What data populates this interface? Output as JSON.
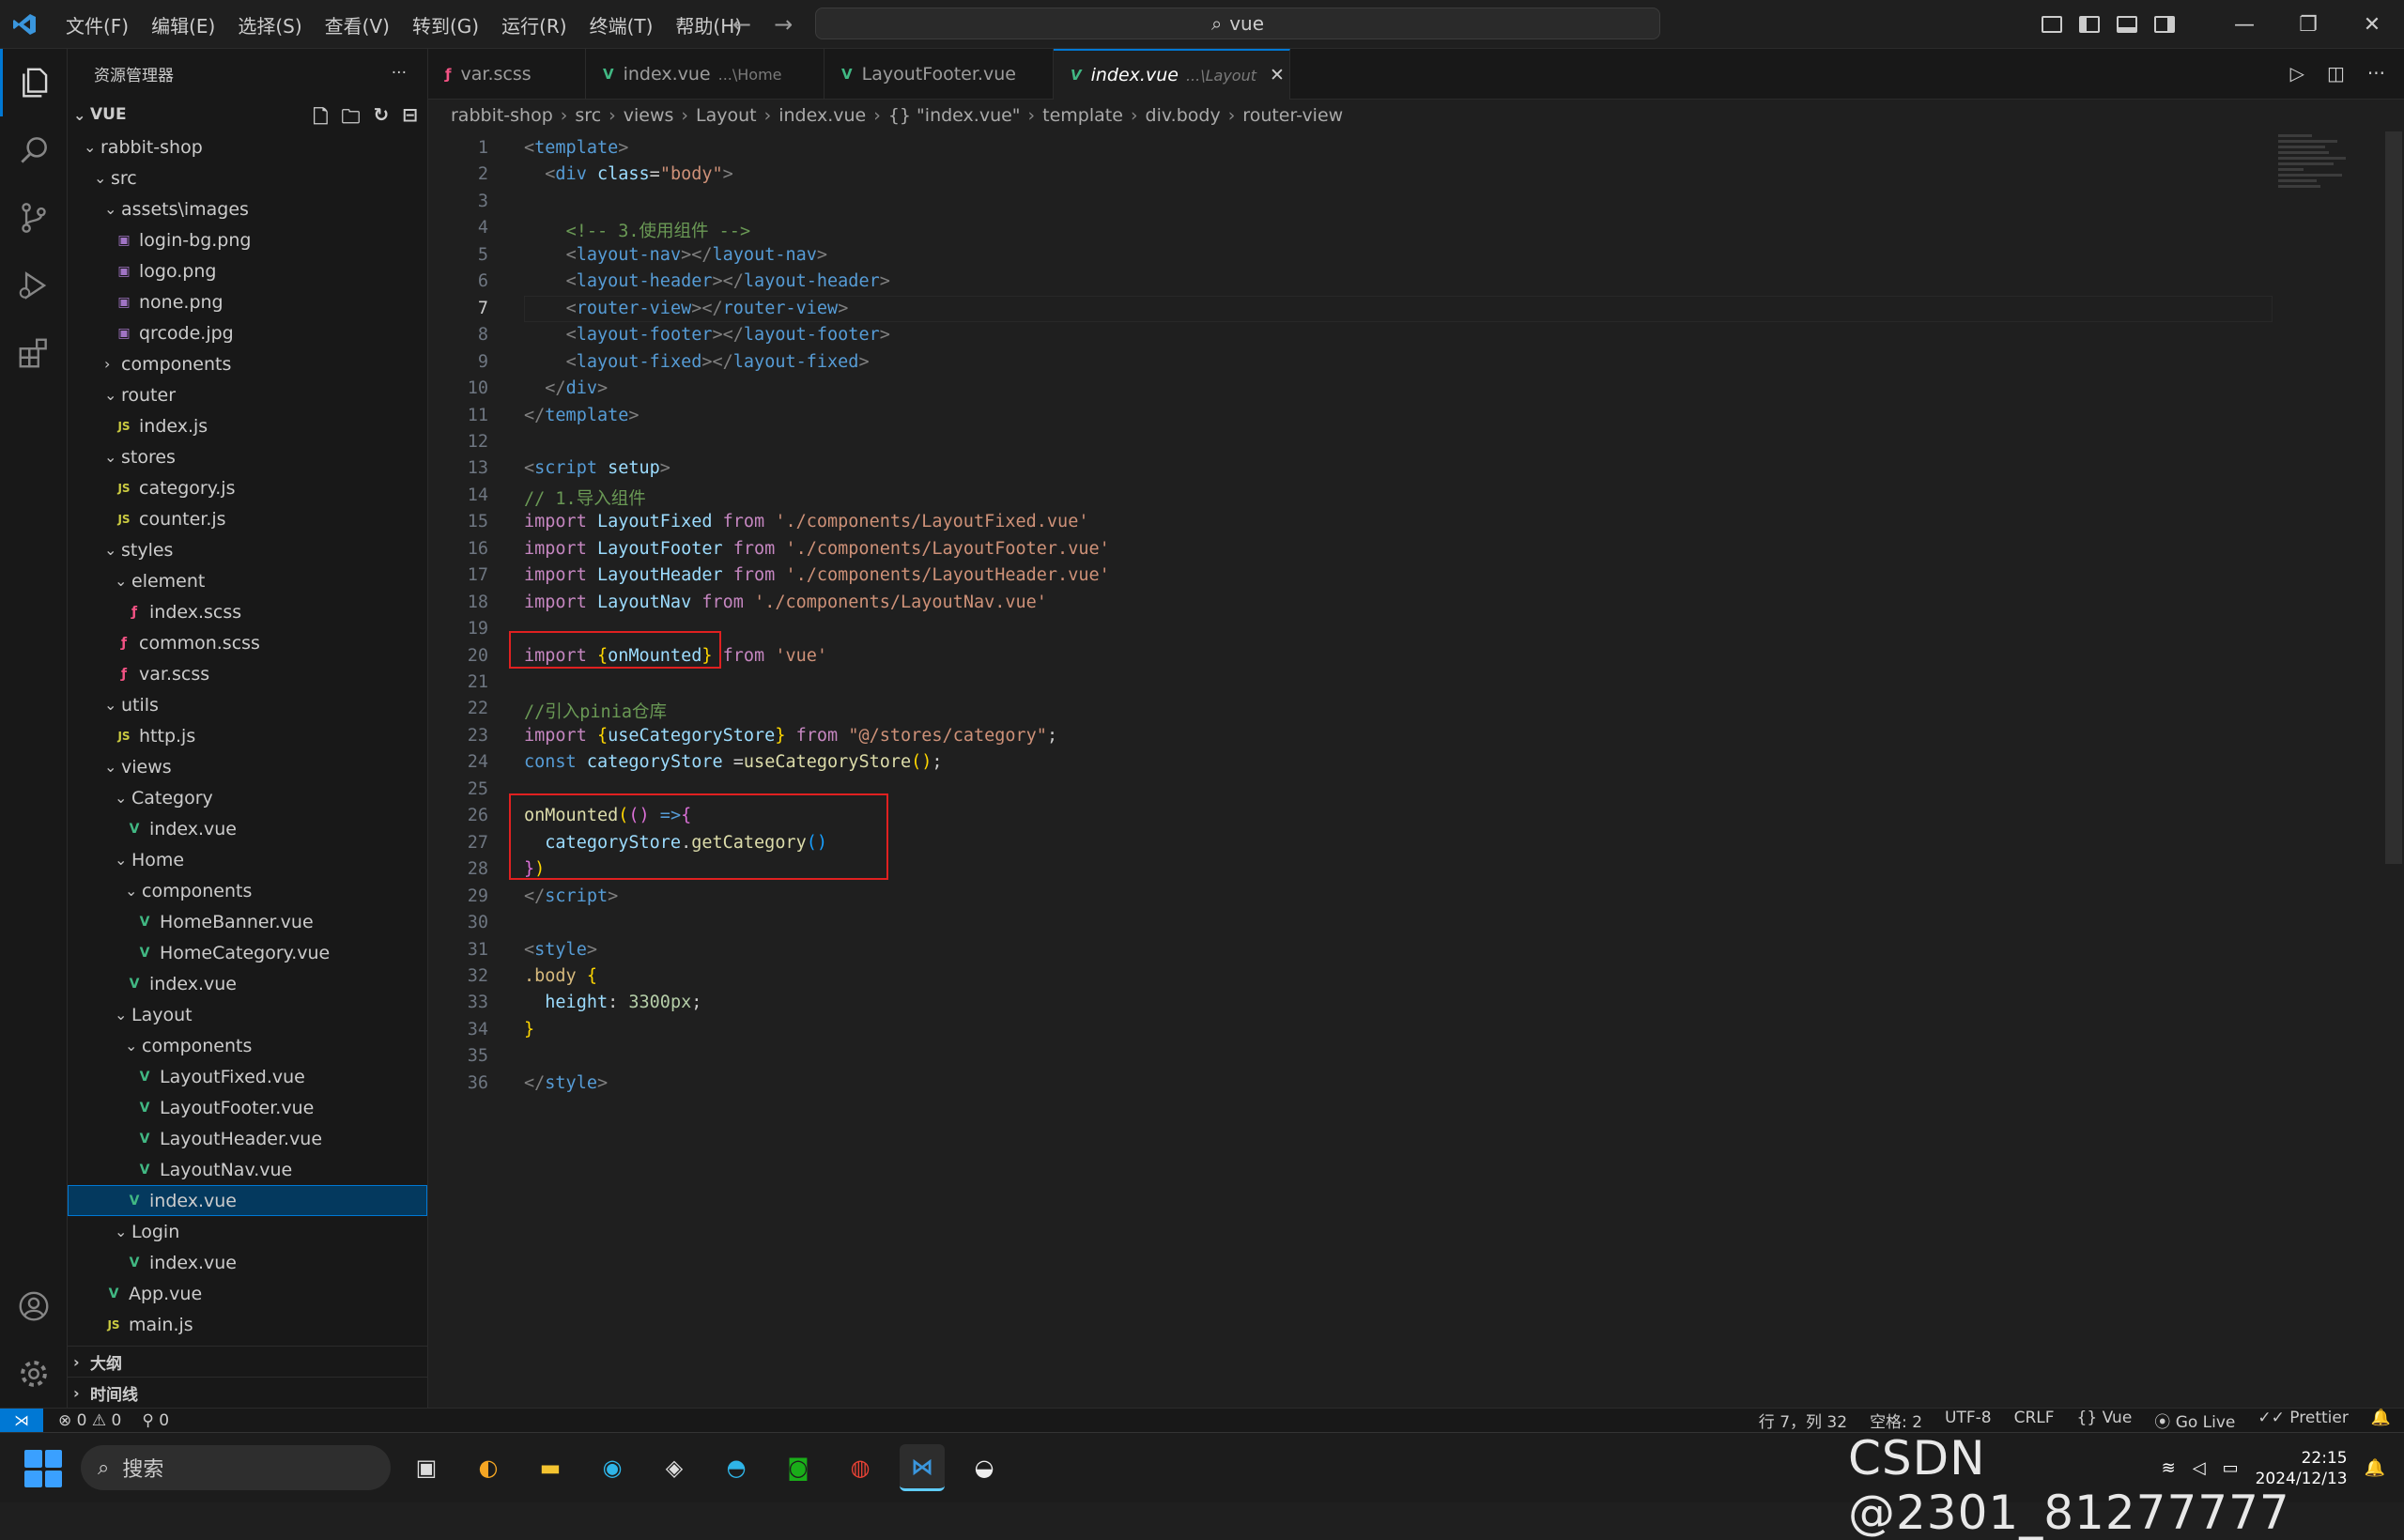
{
  "menu": [
    "文件(F)",
    "编辑(E)",
    "选择(S)",
    "查看(V)",
    "转到(G)",
    "运行(R)",
    "终端(T)",
    "帮助(H)"
  ],
  "command_center": {
    "text": "vue"
  },
  "sidebar": {
    "title": "资源管理器",
    "section": "VUE",
    "outline": "大纲",
    "timeline": "时间线",
    "tree": [
      {
        "label": "rabbit-shop",
        "depth": 1,
        "type": "folder-open"
      },
      {
        "label": "src",
        "depth": 2,
        "type": "folder-open"
      },
      {
        "label": "assets\\images",
        "depth": 3,
        "type": "folder-open"
      },
      {
        "label": "login-bg.png",
        "depth": 4,
        "type": "img"
      },
      {
        "label": "logo.png",
        "depth": 4,
        "type": "img"
      },
      {
        "label": "none.png",
        "depth": 4,
        "type": "img"
      },
      {
        "label": "qrcode.jpg",
        "depth": 4,
        "type": "img"
      },
      {
        "label": "components",
        "depth": 3,
        "type": "folder-closed"
      },
      {
        "label": "router",
        "depth": 3,
        "type": "folder-open"
      },
      {
        "label": "index.js",
        "depth": 4,
        "type": "js"
      },
      {
        "label": "stores",
        "depth": 3,
        "type": "folder-open"
      },
      {
        "label": "category.js",
        "depth": 4,
        "type": "js"
      },
      {
        "label": "counter.js",
        "depth": 4,
        "type": "js"
      },
      {
        "label": "styles",
        "depth": 3,
        "type": "folder-open"
      },
      {
        "label": "element",
        "depth": 4,
        "type": "folder-open"
      },
      {
        "label": "index.scss",
        "depth": 5,
        "type": "scss"
      },
      {
        "label": "common.scss",
        "depth": 4,
        "type": "scss"
      },
      {
        "label": "var.scss",
        "depth": 4,
        "type": "scss"
      },
      {
        "label": "utils",
        "depth": 3,
        "type": "folder-open"
      },
      {
        "label": "http.js",
        "depth": 4,
        "type": "js"
      },
      {
        "label": "views",
        "depth": 3,
        "type": "folder-open"
      },
      {
        "label": "Category",
        "depth": 4,
        "type": "folder-open"
      },
      {
        "label": "index.vue",
        "depth": 5,
        "type": "vue"
      },
      {
        "label": "Home",
        "depth": 4,
        "type": "folder-open"
      },
      {
        "label": "components",
        "depth": 5,
        "type": "folder-open"
      },
      {
        "label": "HomeBanner.vue",
        "depth": 6,
        "type": "vue"
      },
      {
        "label": "HomeCategory.vue",
        "depth": 6,
        "type": "vue"
      },
      {
        "label": "index.vue",
        "depth": 5,
        "type": "vue"
      },
      {
        "label": "Layout",
        "depth": 4,
        "type": "folder-open"
      },
      {
        "label": "components",
        "depth": 5,
        "type": "folder-open"
      },
      {
        "label": "LayoutFixed.vue",
        "depth": 6,
        "type": "vue"
      },
      {
        "label": "LayoutFooter.vue",
        "depth": 6,
        "type": "vue"
      },
      {
        "label": "LayoutHeader.vue",
        "depth": 6,
        "type": "vue"
      },
      {
        "label": "LayoutNav.vue",
        "depth": 6,
        "type": "vue"
      },
      {
        "label": "index.vue",
        "depth": 5,
        "type": "vue",
        "selected": true
      },
      {
        "label": "Login",
        "depth": 4,
        "type": "folder-open"
      },
      {
        "label": "index.vue",
        "depth": 5,
        "type": "vue"
      },
      {
        "label": "App.vue",
        "depth": 3,
        "type": "vue"
      },
      {
        "label": "main.js",
        "depth": 3,
        "type": "js"
      }
    ]
  },
  "tabs": [
    {
      "label": "var.scss",
      "desc": "",
      "icon": "scss",
      "active": false
    },
    {
      "label": "index.vue",
      "desc": "...\\Home",
      "icon": "vue",
      "active": false
    },
    {
      "label": "LayoutFooter.vue",
      "desc": "",
      "icon": "vue",
      "active": false
    },
    {
      "label": "index.vue",
      "desc": "...\\Layout",
      "icon": "vue",
      "active": true
    }
  ],
  "breadcrumbs": [
    "rabbit-shop",
    "src",
    "views",
    "Layout",
    "index.vue",
    "{} \"index.vue\"",
    "template",
    "div.body",
    "router-view"
  ],
  "editor": {
    "current_line": 7,
    "lines": [
      [
        [
          "t-tag",
          "<"
        ],
        [
          "t-name",
          "template"
        ],
        [
          "t-tag",
          ">"
        ]
      ],
      [
        [
          "",
          "  "
        ],
        [
          "t-tag",
          "<"
        ],
        [
          "t-name",
          "div"
        ],
        [
          "",
          ""
        ],
        [
          "t-attr",
          " class"
        ],
        [
          "",
          "="
        ],
        [
          "t-str",
          "\"body\""
        ],
        [
          "t-tag",
          ">"
        ]
      ],
      [],
      [
        [
          "",
          "    "
        ],
        [
          "t-com",
          "<!-- 3.使用组件 -->"
        ]
      ],
      [
        [
          "",
          "    "
        ],
        [
          "t-tag",
          "<"
        ],
        [
          "t-name",
          "layout-nav"
        ],
        [
          "t-tag",
          "></"
        ],
        [
          "t-name",
          "layout-nav"
        ],
        [
          "t-tag",
          ">"
        ]
      ],
      [
        [
          "",
          "    "
        ],
        [
          "t-tag",
          "<"
        ],
        [
          "t-name",
          "layout-header"
        ],
        [
          "t-tag",
          "></"
        ],
        [
          "t-name",
          "layout-header"
        ],
        [
          "t-tag",
          ">"
        ]
      ],
      [
        [
          "",
          "    "
        ],
        [
          "t-tag",
          "<"
        ],
        [
          "t-name",
          "router-view"
        ],
        [
          "t-tag",
          "></"
        ],
        [
          "t-name",
          "router-view"
        ],
        [
          "t-tag",
          ">"
        ]
      ],
      [
        [
          "",
          "    "
        ],
        [
          "t-tag",
          "<"
        ],
        [
          "t-name",
          "layout-footer"
        ],
        [
          "t-tag",
          "></"
        ],
        [
          "t-name",
          "layout-footer"
        ],
        [
          "t-tag",
          ">"
        ]
      ],
      [
        [
          "",
          "    "
        ],
        [
          "t-tag",
          "<"
        ],
        [
          "t-name",
          "layout-fixed"
        ],
        [
          "t-tag",
          "></"
        ],
        [
          "t-name",
          "layout-fixed"
        ],
        [
          "t-tag",
          ">"
        ]
      ],
      [
        [
          "",
          "  "
        ],
        [
          "t-tag",
          "</"
        ],
        [
          "t-name",
          "div"
        ],
        [
          "t-tag",
          ">"
        ]
      ],
      [
        [
          "t-tag",
          "</"
        ],
        [
          "t-name",
          "template"
        ],
        [
          "t-tag",
          ">"
        ]
      ],
      [],
      [
        [
          "t-tag",
          "<"
        ],
        [
          "t-name",
          "script"
        ],
        [
          "t-attr",
          " setup"
        ],
        [
          "t-tag",
          ">"
        ]
      ],
      [
        [
          "t-com",
          "// 1.导入组件"
        ]
      ],
      [
        [
          "t-kw",
          "import"
        ],
        [
          "t-var",
          " LayoutFixed"
        ],
        [
          "t-kw",
          " from"
        ],
        [
          "",
          " "
        ],
        [
          "t-str",
          "'./components/LayoutFixed.vue'"
        ]
      ],
      [
        [
          "t-kw",
          "import"
        ],
        [
          "t-var",
          " LayoutFooter"
        ],
        [
          "t-kw",
          " from"
        ],
        [
          "",
          " "
        ],
        [
          "t-str",
          "'./components/LayoutFooter.vue'"
        ]
      ],
      [
        [
          "t-kw",
          "import"
        ],
        [
          "t-var",
          " LayoutHeader"
        ],
        [
          "t-kw",
          " from"
        ],
        [
          "",
          " "
        ],
        [
          "t-str",
          "'./components/LayoutHeader.vue'"
        ]
      ],
      [
        [
          "t-kw",
          "import"
        ],
        [
          "t-var",
          " LayoutNav"
        ],
        [
          "t-kw",
          " from"
        ],
        [
          "",
          " "
        ],
        [
          "t-str",
          "'./components/LayoutNav.vue'"
        ]
      ],
      [],
      [
        [
          "t-kw",
          "import"
        ],
        [
          "",
          " "
        ],
        [
          "t-br1",
          "{"
        ],
        [
          "t-var",
          "onMounted"
        ],
        [
          "t-br1",
          "}"
        ],
        [
          "t-kw",
          " from"
        ],
        [
          "",
          " "
        ],
        [
          "t-str",
          "'vue'"
        ]
      ],
      [],
      [
        [
          "t-com",
          "//引入pinia仓库"
        ]
      ],
      [
        [
          "t-kw",
          "import"
        ],
        [
          "",
          " "
        ],
        [
          "t-br1",
          "{"
        ],
        [
          "t-var",
          "useCategoryStore"
        ],
        [
          "t-br1",
          "}"
        ],
        [
          "t-kw",
          " from"
        ],
        [
          "",
          " "
        ],
        [
          "t-str",
          "\"@/stores/category\""
        ],
        [
          "",
          ";"
        ]
      ],
      [
        [
          "t-const",
          "const"
        ],
        [
          "t-var",
          " categoryStore"
        ],
        [
          "",
          " ="
        ],
        [
          "t-fn",
          "useCategoryStore"
        ],
        [
          "t-br1",
          "()"
        ],
        [
          "",
          ";"
        ]
      ],
      [],
      [
        [
          "t-fn",
          "onMounted"
        ],
        [
          "t-br1",
          "("
        ],
        [
          "t-br2",
          "()"
        ],
        [
          "t-const",
          " =>"
        ],
        [
          "t-br2",
          "{"
        ]
      ],
      [
        [
          "",
          "  "
        ],
        [
          "t-var",
          "categoryStore"
        ],
        [
          "",
          "."
        ],
        [
          "t-fn",
          "getCategory"
        ],
        [
          "t-br3",
          "()"
        ]
      ],
      [
        [
          "t-br2",
          "}"
        ],
        [
          "t-br1",
          ")"
        ]
      ],
      [
        [
          "t-tag",
          "</"
        ],
        [
          "t-name",
          "script"
        ],
        [
          "t-tag",
          ">"
        ]
      ],
      [],
      [
        [
          "t-tag",
          "<"
        ],
        [
          "t-name",
          "style"
        ],
        [
          "t-tag",
          ">"
        ]
      ],
      [
        [
          "t-sel",
          ".body"
        ],
        [
          "",
          " "
        ],
        [
          "t-br1",
          "{"
        ]
      ],
      [
        [
          "",
          "  "
        ],
        [
          "t-attr",
          "height"
        ],
        [
          "",
          ": "
        ],
        [
          "t-num",
          "3300px"
        ],
        [
          "",
          ";"
        ]
      ],
      [
        [
          "t-br1",
          "}"
        ]
      ],
      [],
      [
        [
          "t-tag",
          "</"
        ],
        [
          "t-name",
          "style"
        ],
        [
          "t-tag",
          ">"
        ]
      ]
    ]
  },
  "statusbar": {
    "errors": "0",
    "warnings": "0",
    "ports": "0",
    "position": "行 7，列 32",
    "spaces": "空格: 2",
    "encoding": "UTF-8",
    "eol": "CRLF",
    "language": "Vue",
    "golive": "Go Live",
    "prettier": "Prettier"
  },
  "taskbar": {
    "search": "搜索",
    "time": "22:15",
    "date": "2024/12/13"
  },
  "watermark": "CSDN @2301_81277777"
}
